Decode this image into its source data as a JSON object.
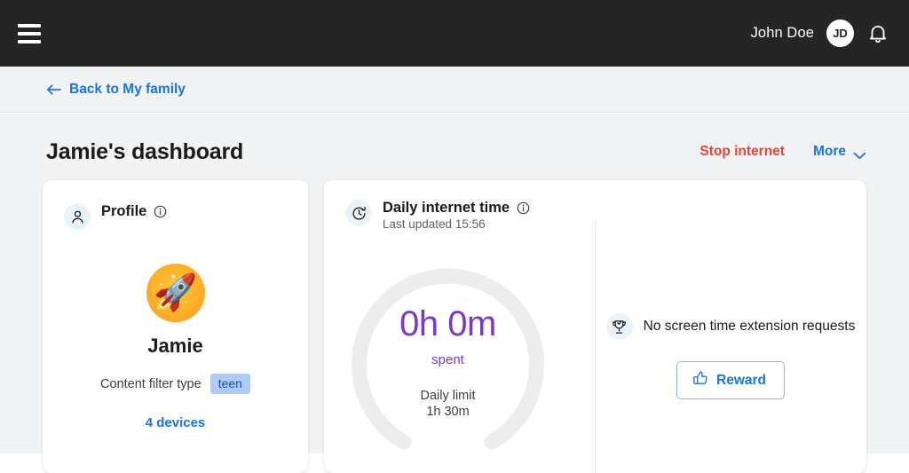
{
  "topbar": {
    "menu_icon": "hamburger-menu-icon",
    "user_name": "John Doe",
    "user_initials": "JD",
    "notifications_icon": "bell-icon"
  },
  "subbar": {
    "back_label": "Back to My family",
    "back_icon": "arrow-left-icon"
  },
  "page": {
    "title": "Jamie's dashboard",
    "actions": {
      "stop_internet": "Stop internet",
      "more": "More",
      "more_icon": "chevron-down-icon"
    },
    "annotation": {
      "type": "arrow-right-annotation",
      "color": "#f93905",
      "points_to": "Stop internet"
    }
  },
  "profile_card": {
    "header_icon": "person-icon",
    "title": "Profile",
    "info_icon": "info-icon",
    "avatar_icon": "rocket-emoji-avatar",
    "avatar_glyph": "🚀",
    "name": "Jamie",
    "filter_label": "Content filter type",
    "filter_value": "teen",
    "devices_link": "4 devices"
  },
  "time_card": {
    "header_icon": "clock-history-icon",
    "title": "Daily internet time",
    "info_icon": "info-icon",
    "subtitle": "Last updated 15:56",
    "gauge": {
      "value": "0h 0m",
      "value_caption": "spent",
      "limit_label": "Daily limit",
      "limit_value": "1h 30m",
      "track_color": "#ededee",
      "value_color": "#7b36d6",
      "percent_filled": 0
    },
    "requests": {
      "icon": "trophy-check-icon",
      "text": "No screen time extension requests",
      "reward_button": "Reward",
      "reward_icon": "thumbs-up-icon"
    }
  },
  "colors": {
    "topbar_bg": "#252525",
    "page_bg": "#f1f3f4",
    "link_blue": "#1a73e8",
    "danger_red": "#ea4335",
    "accent_purple": "#7b36d6",
    "badge_blue": "#aecbfa",
    "annotation_red": "#f93905"
  }
}
